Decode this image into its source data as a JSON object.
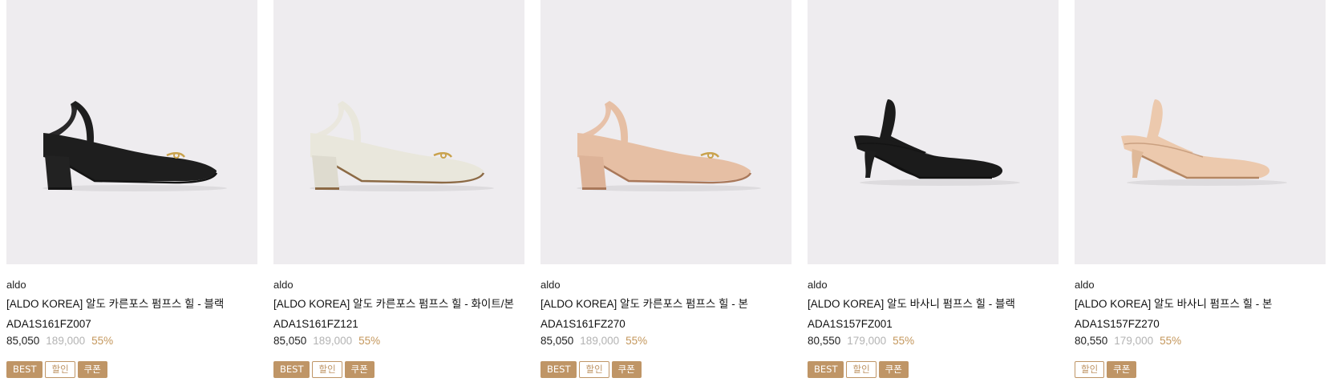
{
  "products": [
    {
      "brand": "aldo",
      "title": "[ALDO KOREA] 알도 카른포스 펌프스 힐 - 블랙",
      "code": "ADA1S161FZ007",
      "price": "85,050",
      "original_price": "189,000",
      "discount": "55%",
      "badges": [
        "BEST",
        "할인",
        "쿠폰"
      ],
      "shoe_style": "block",
      "shoe_color": "#1e1e1e",
      "sole_color": "#141414",
      "heel_color": "#222222",
      "image": "black block-heel slingback pump"
    },
    {
      "brand": "aldo",
      "title": "[ALDO KOREA] 알도 카른포스 펌프스 힐 - 화이트/본",
      "code": "ADA1S161FZ121",
      "price": "85,050",
      "original_price": "189,000",
      "discount": "55%",
      "badges": [
        "BEST",
        "할인",
        "쿠폰"
      ],
      "shoe_style": "block",
      "shoe_color": "#e9e7dc",
      "sole_color": "#8c6a45",
      "heel_color": "#dedbcf",
      "image": "white block-heel slingback pump"
    },
    {
      "brand": "aldo",
      "title": "[ALDO KOREA] 알도 카른포스 펌프스 힐 - 본",
      "code": "ADA1S161FZ270",
      "price": "85,050",
      "original_price": "189,000",
      "discount": "55%",
      "badges": [
        "BEST",
        "할인",
        "쿠폰"
      ],
      "shoe_style": "block",
      "shoe_color": "#e6bfa4",
      "sole_color": "#a9785a",
      "heel_color": "#ddb398",
      "image": "bone block-heel slingback pump"
    },
    {
      "brand": "aldo",
      "title": "[ALDO KOREA] 알도 바사니 펌프스 힐 - 블랙",
      "code": "ADA1S157FZ001",
      "price": "80,550",
      "original_price": "179,000",
      "discount": "55%",
      "badges": [
        "BEST",
        "할인",
        "쿠폰"
      ],
      "shoe_style": "kitten",
      "shoe_color": "#1b1b1b",
      "sole_color": "#111111",
      "heel_color": "#1d1d1d",
      "image": "black kitten-heel slingback pump"
    },
    {
      "brand": "aldo",
      "title": "[ALDO KOREA] 알도 바사니 펌프스 힐 - 본",
      "code": "ADA1S157FZ270",
      "price": "80,550",
      "original_price": "179,000",
      "discount": "55%",
      "badges": [
        "할인",
        "쿠폰"
      ],
      "shoe_style": "kitten",
      "shoe_color": "#ecc9ad",
      "sole_color": "#b48662",
      "heel_color": "#dfb999",
      "image": "bone kitten-heel slingback pump"
    }
  ],
  "colors": {
    "image_bg": "#eeecef",
    "badge": "#bf9566",
    "discount": "#c4975c",
    "original_price": "#b3b3b3"
  }
}
